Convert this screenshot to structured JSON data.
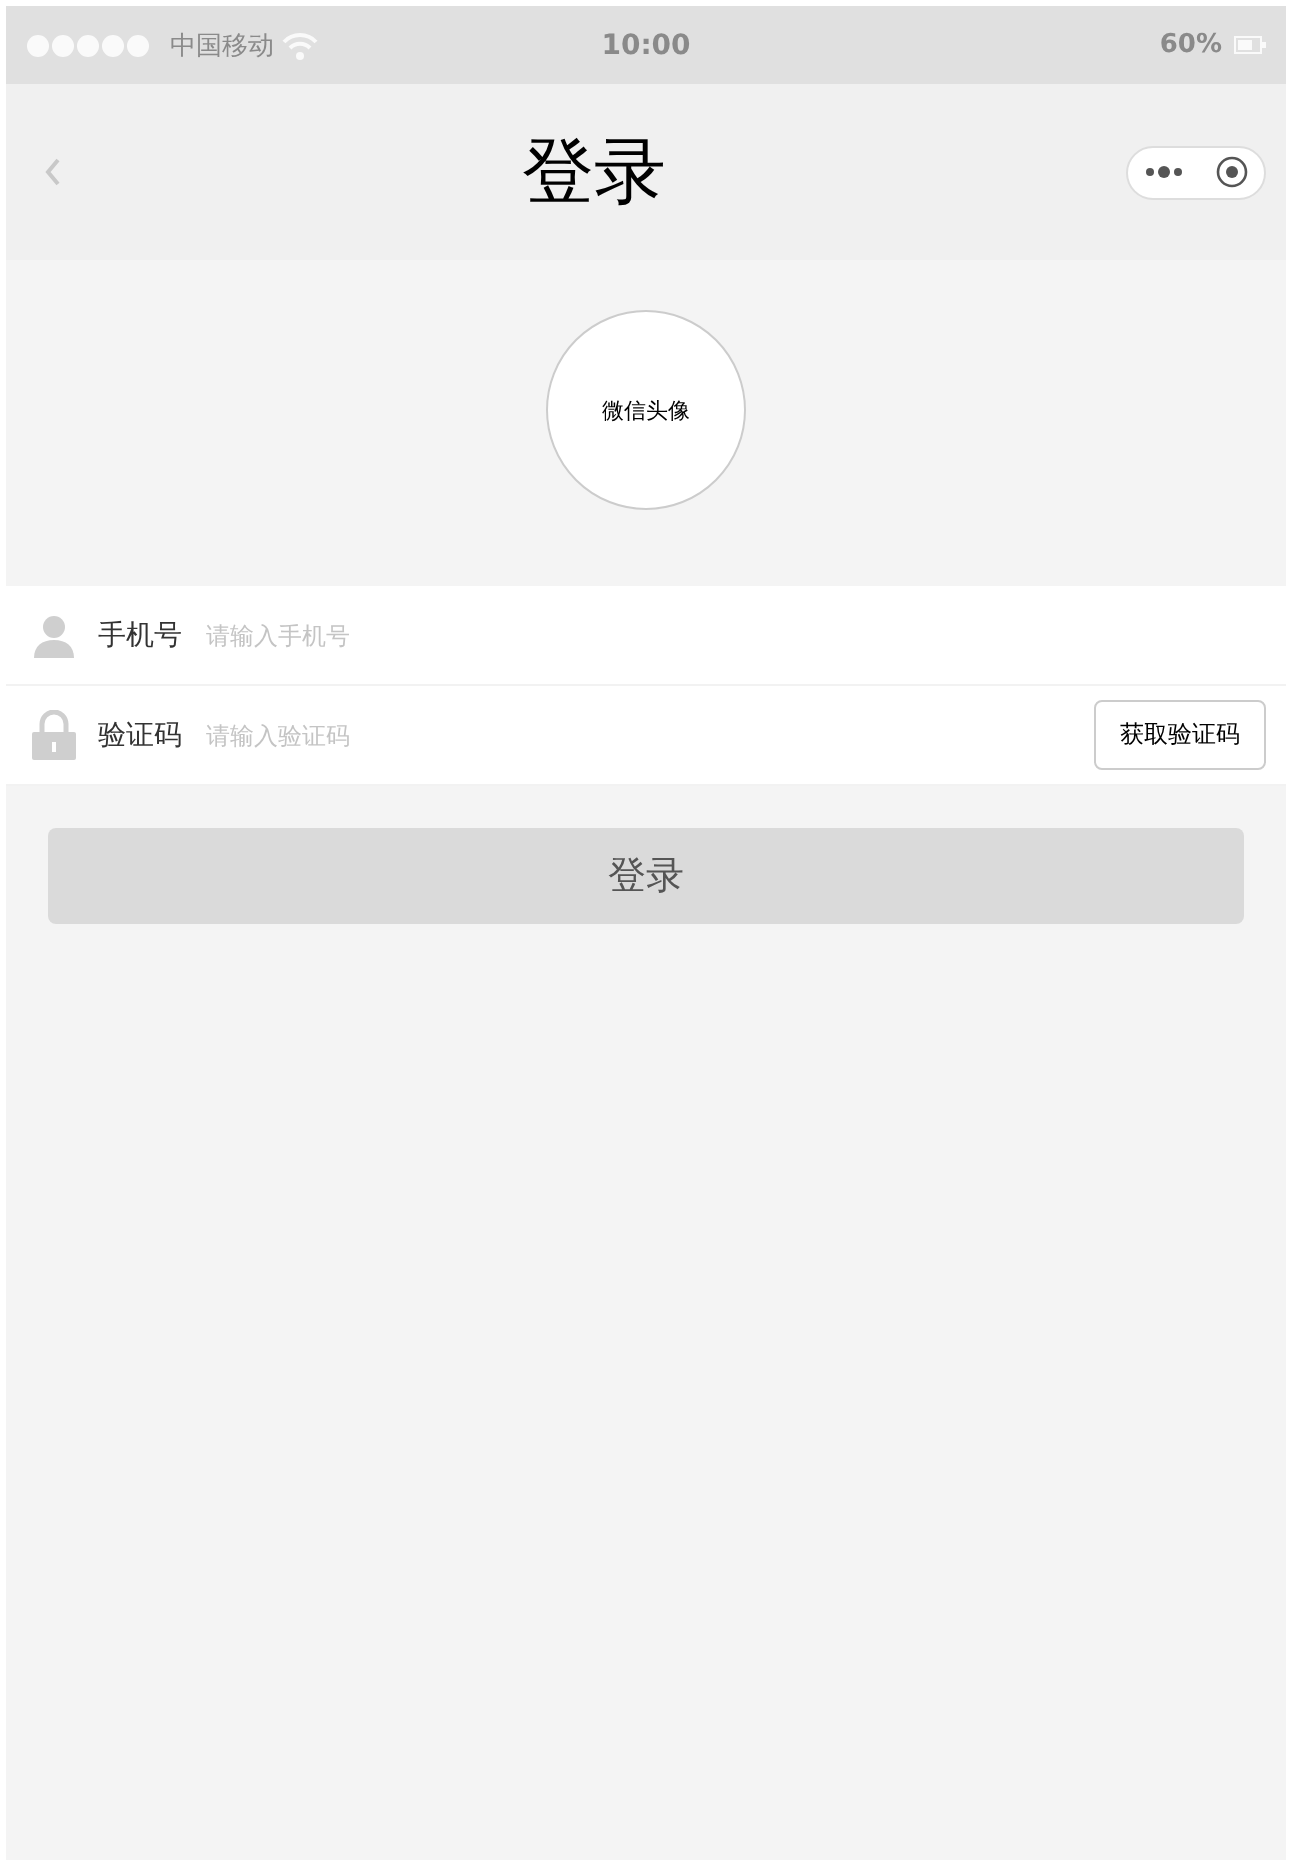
{
  "status_bar": {
    "carrier": "中国移动",
    "time": "10:00",
    "battery": "60%"
  },
  "nav": {
    "title": "登录"
  },
  "avatar": {
    "label": "微信头像"
  },
  "fields": [
    {
      "kind": "person",
      "label": "手机号",
      "placeholder": "请输入手机号"
    },
    {
      "kind": "lock",
      "label": "验证码",
      "placeholder": "请输入验证码",
      "action": "获取验证码"
    }
  ],
  "submit": {
    "label": "登录",
    "disabled": true
  }
}
